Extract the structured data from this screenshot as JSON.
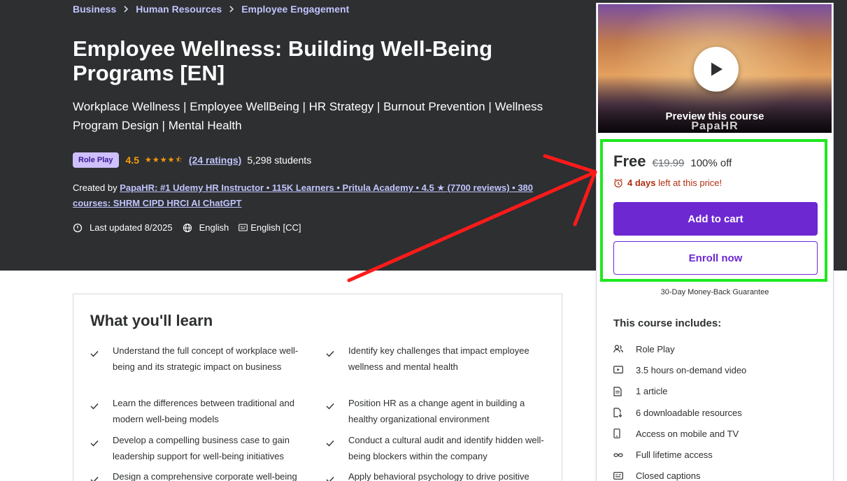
{
  "breadcrumb": {
    "items": [
      "Business",
      "Human Resources",
      "Employee Engagement"
    ]
  },
  "course": {
    "title": "Employee Wellness: Building Well-Being Programs [EN]",
    "subtitle": "Workplace Wellness | Employee WellBeing | HR Strategy | Burnout Prevention | Wellness Program Design | Mental Health",
    "badge": "Role Play",
    "rating": "4.5",
    "stars": "★★★★⯪",
    "ratings_count": "(24 ratings)",
    "students": "5,298 students",
    "created_by_label": "Created by",
    "instructor": "PapaHR: #1 Udemy HR Instructor • 115K Learners • Pritula Academy • 4.5 ★ (7700 reviews) • 380 courses: SHRM CIPD HRCI AI ChatGPT",
    "last_updated": "Last updated 8/2025",
    "language": "English",
    "captions": "English [CC]"
  },
  "card": {
    "preview_label": "Preview this course",
    "brand": "PapaHR",
    "price_current": "Free",
    "price_original": "€19.99",
    "discount": "100% off",
    "timer_days": "4 days",
    "timer_text": "left at this price!",
    "add_to_cart": "Add to cart",
    "enroll_now": "Enroll now",
    "guarantee": "30-Day Money-Back Guarantee",
    "includes_title": "This course includes:",
    "includes": [
      {
        "icon": "people-icon",
        "label": "Role Play"
      },
      {
        "icon": "video-icon",
        "label": "3.5 hours on-demand video"
      },
      {
        "icon": "article-icon",
        "label": "1 article"
      },
      {
        "icon": "download-icon",
        "label": "6 downloadable resources"
      },
      {
        "icon": "mobile-icon",
        "label": "Access on mobile and TV"
      },
      {
        "icon": "infinity-icon",
        "label": "Full lifetime access"
      },
      {
        "icon": "captions-icon",
        "label": "Closed captions"
      }
    ]
  },
  "learn": {
    "title": "What you'll learn",
    "items": [
      "Understand the full concept of workplace well-being and its strategic impact on business",
      "Identify key challenges that impact employee wellness and mental health",
      "Learn the differences between traditional and modern well-being models",
      "Position HR as a change agent in building a healthy organizational environment",
      "Develop a compelling business case to gain leadership support for well-being initiatives",
      "Conduct a cultural audit and identify hidden well-being blockers within the company",
      "Design a comprehensive corporate well-being",
      "Apply behavioral psychology to drive positive"
    ]
  },
  "colors": {
    "hero_bg": "#2d2f31",
    "link": "#c0c4fc",
    "accent_purple": "#6d28d2",
    "star": "#f69c08",
    "timer": "#b32d0f",
    "highlight": "#1ee81e",
    "arrow": "#ff1a1a"
  }
}
